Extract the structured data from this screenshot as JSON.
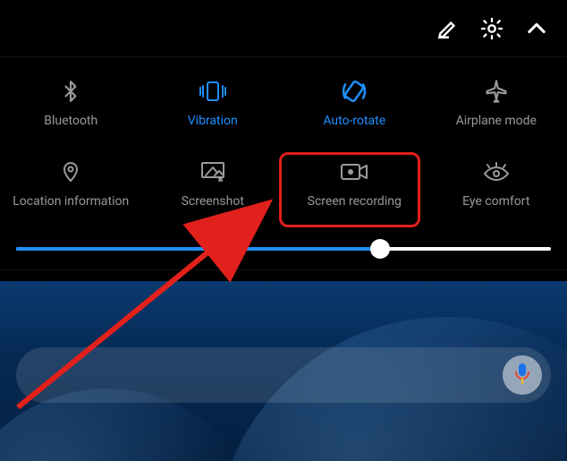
{
  "topbar": {
    "icons": [
      "edit",
      "settings",
      "collapse"
    ]
  },
  "tiles": [
    {
      "id": "bluetooth",
      "label": "Bluetooth",
      "active": false
    },
    {
      "id": "vibration",
      "label": "Vibration",
      "active": true
    },
    {
      "id": "autorotate",
      "label": "Auto-rotate",
      "active": true
    },
    {
      "id": "airplane",
      "label": "Airplane mode",
      "active": false
    },
    {
      "id": "location",
      "label": "Location information",
      "active": false
    },
    {
      "id": "screenshot",
      "label": "Screenshot",
      "active": false
    },
    {
      "id": "screenrecord",
      "label": "Screen recording",
      "active": false
    },
    {
      "id": "eyecomfort",
      "label": "Eye comfort",
      "active": false
    }
  ],
  "brightness": {
    "value": 68
  },
  "highlight": {
    "target_tile": "screenrecord",
    "color": "#e2201c"
  },
  "search": {
    "placeholder": ""
  },
  "colors": {
    "accent": "#1e90ff",
    "inactive": "#9a9a9a",
    "highlight": "#e2201c"
  }
}
